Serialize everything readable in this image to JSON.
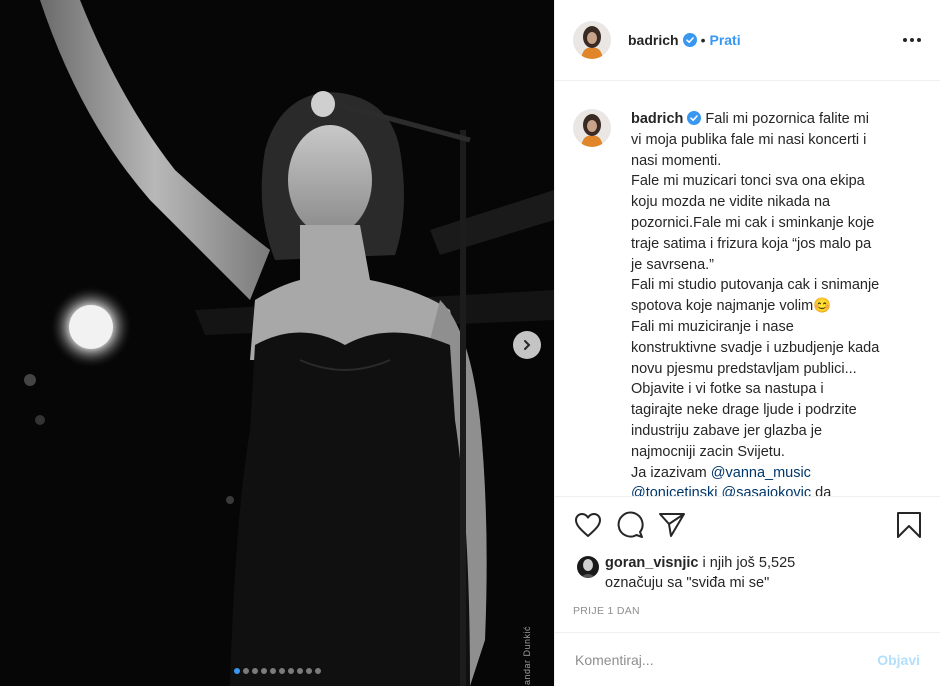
{
  "header": {
    "username": "badrich",
    "bullet": "•",
    "follow_label": "Prati"
  },
  "caption": {
    "username": "badrich",
    "lines": [
      "Fali mi pozornica falite mi",
      "vi moja publika fale mi nasi koncerti i",
      "nasi momenti.",
      "Fale mi muzicari tonci sva ona ekipa",
      "koju mozda ne vidite nikada na",
      "pozornici.Fale mi cak i sminkanje koje",
      "traje satima i frizura koja “jos malo pa",
      "je savrsena.”",
      "Fali mi studio putovanja cak i snimanje",
      "spotova koje najmanje volim😊",
      "Fali mi muziciranje i nase",
      "konstruktivne svadje i uzbudjenje kada",
      "novu pjesmu predstavljam publici...",
      "Objavite i vi fotke sa nastupa i",
      "tagirajte neke drage ljude i podrzite",
      "industriju zabave jer glazba je",
      "najmocniji zacin Svijetu."
    ],
    "challenge_prefix": "Ja izazivam ",
    "mention_1": "@vanna_music",
    "mention_2": "@tonicetinski",
    "mention_3": "@sasajokovic",
    "trailing": " da"
  },
  "likes": {
    "user": "goran_visnjic",
    "rest": " i njih još 5,525",
    "line2": "označuju sa \"sviđa mi se\""
  },
  "time": "PRIJE 1 DAN",
  "comment": {
    "placeholder": "Komentiraj...",
    "post_label": "Objavi"
  },
  "media": {
    "credit": "andar Dunkić",
    "slide_count": 10,
    "active_slide": 1
  },
  "colors": {
    "accent": "#3897f0",
    "post_disabled": "#b2dffc"
  }
}
